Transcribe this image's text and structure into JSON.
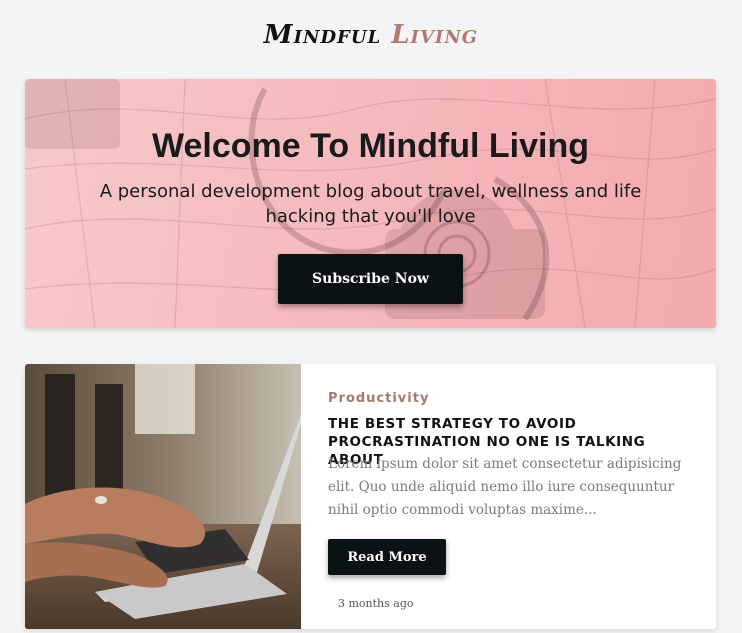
{
  "logo": {
    "part1": "Mindful",
    "part2": "Living"
  },
  "hero": {
    "title_prefix": "Welcome To",
    "title_strong": "Mindful Living",
    "subtitle": "A personal development blog about travel, wellness and life hacking that you'll love",
    "button_label": "Subscribe Now"
  },
  "post": {
    "category": "Productivity",
    "title": "THE BEST STRATEGY TO AVOID PROCRASTINATION NO ONE IS TALKING ABOUT",
    "excerpt": "Lorem ipsum dolor sit amet consectetur adipisicing elit. Quo unde aliquid nemo illo iure consequuntur nihil optio commodi voluptas maxime...",
    "button_label": "Read More",
    "time": "3 months ago"
  },
  "colors": {
    "accent": "#b07a74",
    "button": "#0b1214",
    "hero_bg": "#f5b7bb"
  }
}
